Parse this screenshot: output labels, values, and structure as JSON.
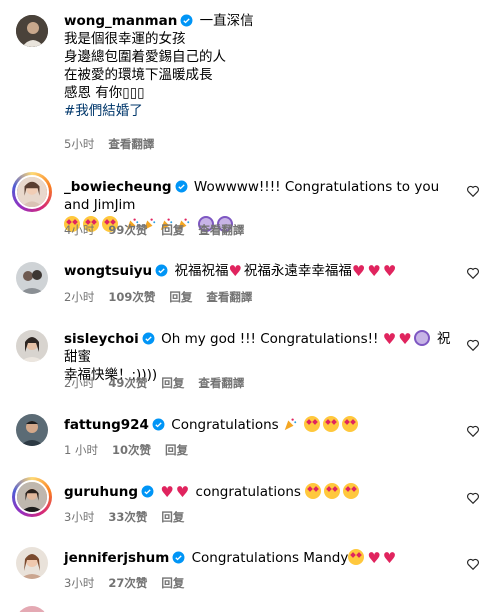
{
  "caption": {
    "username": "wong_manman",
    "first_line": "一直深信",
    "lines": [
      "我是個很幸運的女孩",
      "身邊總包圍着愛錫自己的人",
      "在被愛的環境下溫暖成長",
      "感恩 有你▯▯▯"
    ],
    "hashtag": "#我們結婚了",
    "time": "5小时",
    "translate": "查看翻譯"
  },
  "comments": [
    {
      "username": "_bowiecheung",
      "text": "Wowwww!!!! Congratulations to you and JimJim",
      "time": "4小时",
      "likes": "99次赞",
      "reply": "回复",
      "translate": "查看翻譯"
    },
    {
      "username": "wongtsuiyu",
      "text1": "祝福祝福",
      "text2": "祝福永遠幸幸福福",
      "time": "2小时",
      "likes": "109次赞",
      "reply": "回复",
      "translate": "查看翻譯"
    },
    {
      "username": "sisleychoi",
      "text1": "Oh my god !!! Congratulations!!",
      "text2": "祝甜蜜",
      "text3": "幸福快樂！:))))",
      "time": "2小时",
      "likes": "49次赞",
      "reply": "回复",
      "translate": "查看翻譯"
    },
    {
      "username": "fattung924",
      "text": "Congratulations",
      "time": "1 小时",
      "likes": "10次赞",
      "reply": "回复"
    },
    {
      "username": "guruhung",
      "text": "congratulations",
      "time": "3小时",
      "likes": "33次赞",
      "reply": "回复"
    },
    {
      "username": "jenniferjshum",
      "text": "Congratulations Mandy",
      "time": "3小时",
      "likes": "27次赞",
      "reply": "回复"
    }
  ],
  "colors": {
    "verified": "#0095f6",
    "meta": "#737373",
    "hashtag": "#00376b",
    "heart_stroke": "#262626"
  }
}
